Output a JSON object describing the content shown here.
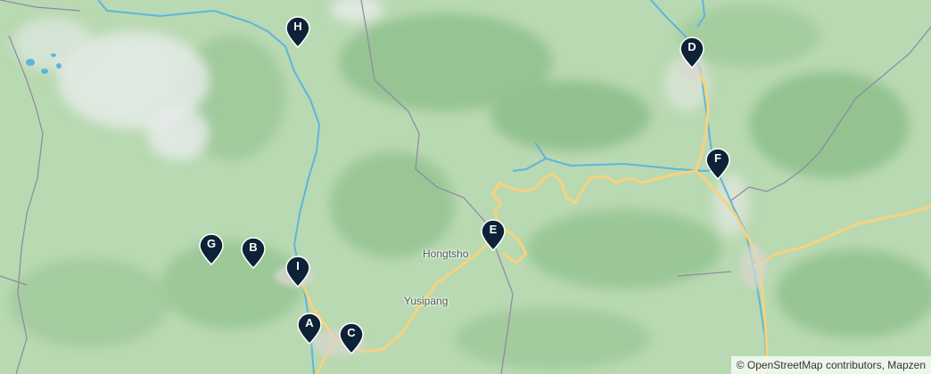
{
  "map": {
    "places": {
      "hongtsho": "Hongtsho",
      "yusipang": "Yusipang"
    },
    "markers": [
      {
        "id": "a",
        "label": "A"
      },
      {
        "id": "b",
        "label": "B"
      },
      {
        "id": "c",
        "label": "C"
      },
      {
        "id": "d",
        "label": "D"
      },
      {
        "id": "e",
        "label": "E"
      },
      {
        "id": "f",
        "label": "F"
      },
      {
        "id": "g",
        "label": "G"
      },
      {
        "id": "h",
        "label": "H"
      },
      {
        "id": "i",
        "label": "I"
      }
    ],
    "attribution": "© OpenStreetMap contributors, Mapzen"
  },
  "colors": {
    "land": "#b9d9b2",
    "terrain_dark": "#8fc08d",
    "snow": "#e8ecec",
    "river": "#5fb4dd",
    "road": "#f7d27e",
    "border": "#9087a6",
    "marker": "#0d2237"
  },
  "icons": {
    "marker": "map-pin-icon"
  }
}
